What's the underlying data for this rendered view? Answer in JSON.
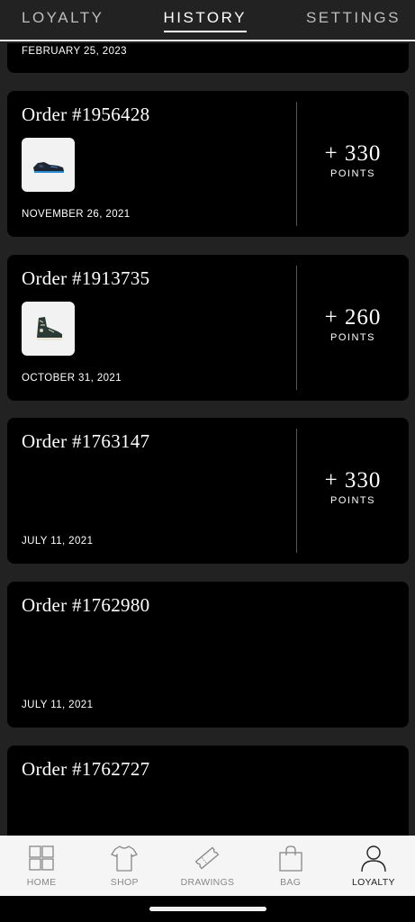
{
  "top_tabs": [
    {
      "label": "LOYALTY",
      "active": false
    },
    {
      "label": "HISTORY",
      "active": true
    },
    {
      "label": "SETTINGS",
      "active": false
    }
  ],
  "orders": [
    {
      "title": "",
      "date": "FEBRUARY 25, 2023",
      "points": "",
      "points_label": ""
    },
    {
      "title": "Order #1956428",
      "date": "NOVEMBER 26, 2021",
      "points": "+ 330",
      "points_label": "POINTS",
      "product_icon": "sneaker-low-icon"
    },
    {
      "title": "Order #1913735",
      "date": "OCTOBER 31, 2021",
      "points": "+ 260",
      "points_label": "POINTS",
      "product_icon": "sneaker-high-icon"
    },
    {
      "title": "Order #1763147",
      "date": "JULY 11, 2021",
      "points": "+ 330",
      "points_label": "POINTS"
    },
    {
      "title": "Order #1762980",
      "date": "JULY 11, 2021",
      "points": "",
      "points_label": ""
    },
    {
      "title": "Order #1762727",
      "date": "",
      "points": "",
      "points_label": ""
    }
  ],
  "bottom_nav": [
    {
      "label": "HOME",
      "icon": "grid-icon",
      "active": false
    },
    {
      "label": "SHOP",
      "icon": "tshirt-icon",
      "active": false
    },
    {
      "label": "DRAWINGS",
      "icon": "ticket-icon",
      "active": false
    },
    {
      "label": "BAG",
      "icon": "bag-icon",
      "active": false
    },
    {
      "label": "LOYALTY",
      "icon": "person-icon",
      "active": true
    }
  ],
  "colors": {
    "card_bg": "#000000",
    "page_bg": "#222222",
    "nav_bg": "#f5f5f5"
  }
}
